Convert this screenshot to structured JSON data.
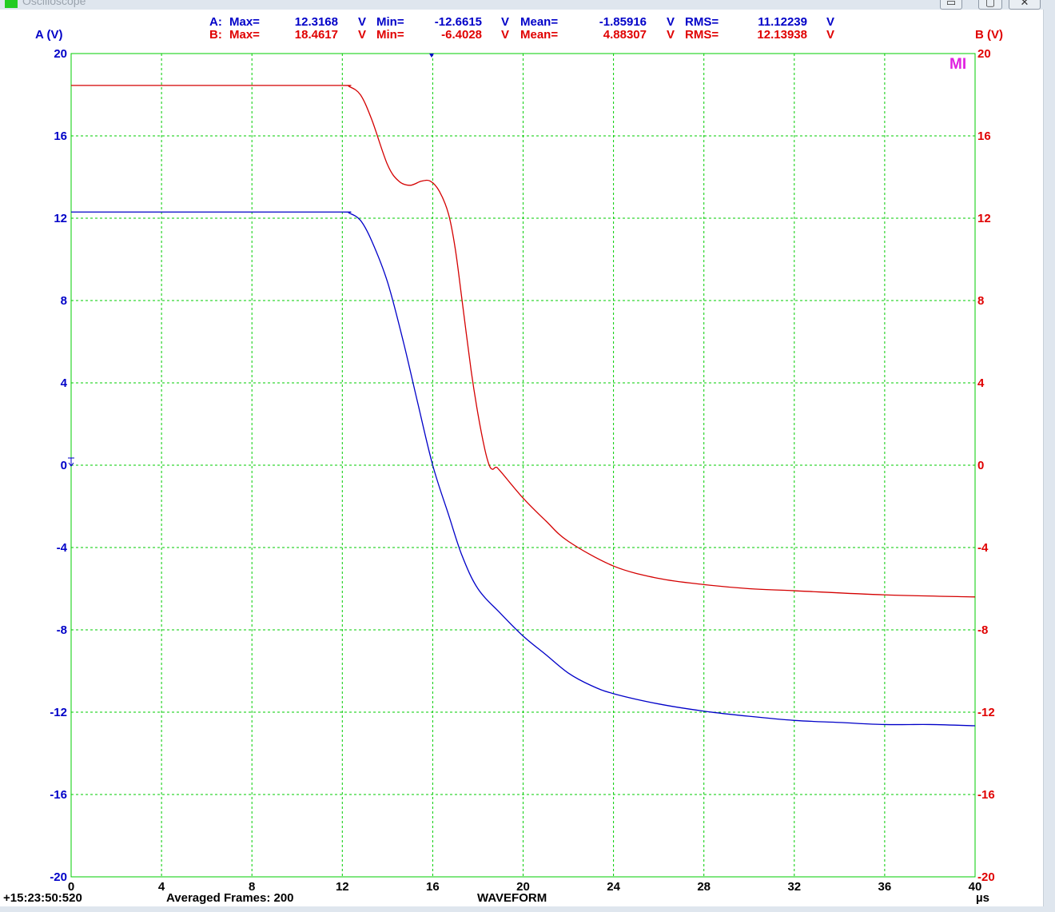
{
  "window": {
    "title": "Oscilloscope",
    "minimize_glyph": "▭",
    "maximize_glyph": "▢",
    "close_glyph": "✕"
  },
  "stats": {
    "a": {
      "label": "A:",
      "max_label": "Max=",
      "max": "12.3168",
      "max_unit": "V",
      "min_label": "Min=",
      "min": "-12.6615",
      "min_unit": "V",
      "mean_label": "Mean=",
      "mean": "-1.85916",
      "mean_unit": "V",
      "rms_label": "RMS=",
      "rms": "11.12239",
      "rms_unit": "V"
    },
    "b": {
      "label": "B:",
      "max_label": "Max=",
      "max": "18.4617",
      "max_unit": "V",
      "min_label": "Min=",
      "min": "-6.4028",
      "min_unit": "V",
      "mean_label": "Mean=",
      "mean": "4.88307",
      "mean_unit": "V",
      "rms_label": "RMS=",
      "rms": "12.13938",
      "rms_unit": "V"
    }
  },
  "marker_label": "MI",
  "footer": {
    "timestamp": "+15:23:50:520",
    "averaged_frames": "Averaged Frames: 200",
    "mode": "WAVEFORM",
    "x_unit": "µs"
  },
  "chart_data": {
    "type": "line",
    "title": "",
    "xlabel": "µs",
    "ylabel_left": "A (V)",
    "ylabel_right": "B (V)",
    "xlim": [
      0,
      40
    ],
    "ylim": [
      -20,
      20
    ],
    "x_ticks": [
      "0",
      "4",
      "8",
      "12",
      "16",
      "20",
      "24",
      "28",
      "32",
      "36",
      "40"
    ],
    "y_ticks": [
      "20",
      "16",
      "12",
      "8",
      "4",
      "0",
      "-4",
      "-8",
      "-12",
      "-16",
      "-20"
    ],
    "grid": true,
    "colors": {
      "series_a": "#0000c8",
      "series_b": "#d40000",
      "grid": "#00cc00",
      "left_axis_text": "#0000c8",
      "right_axis_text": "#e00000",
      "marker": "#e020e0"
    },
    "series": [
      {
        "name": "A",
        "x": [
          0,
          4,
          8,
          12,
          12.3,
          12.8,
          13.3,
          14,
          14.7,
          15.3,
          16,
          16.7,
          17.3,
          18,
          19,
          20,
          21,
          22,
          23,
          24,
          26,
          28,
          30,
          32,
          34,
          36,
          38,
          40
        ],
        "y": [
          12.3,
          12.3,
          12.3,
          12.3,
          12.25,
          11.9,
          10.9,
          8.9,
          6.0,
          3.2,
          0.0,
          -2.4,
          -4.4,
          -6.0,
          -7.2,
          -8.3,
          -9.2,
          -10.1,
          -10.7,
          -11.1,
          -11.6,
          -11.95,
          -12.2,
          -12.4,
          -12.5,
          -12.6,
          -12.6,
          -12.66
        ]
      },
      {
        "name": "B",
        "x": [
          0,
          4,
          8,
          12,
          12.3,
          12.8,
          13.3,
          14,
          14.5,
          15,
          15.5,
          15.9,
          16.3,
          16.7,
          17,
          17.3,
          17.7,
          18,
          18.3,
          18.5,
          18.65,
          18.8,
          19,
          20,
          21,
          22,
          24,
          26,
          28,
          30,
          32,
          36,
          40
        ],
        "y": [
          18.45,
          18.45,
          18.45,
          18.45,
          18.4,
          18.0,
          16.8,
          14.6,
          13.8,
          13.6,
          13.8,
          13.8,
          13.3,
          12.2,
          10.5,
          8.0,
          4.6,
          2.5,
          0.8,
          0.0,
          -0.2,
          -0.1,
          -0.3,
          -1.6,
          -2.7,
          -3.7,
          -4.9,
          -5.5,
          -5.8,
          -6.0,
          -6.1,
          -6.3,
          -6.4
        ]
      }
    ]
  }
}
